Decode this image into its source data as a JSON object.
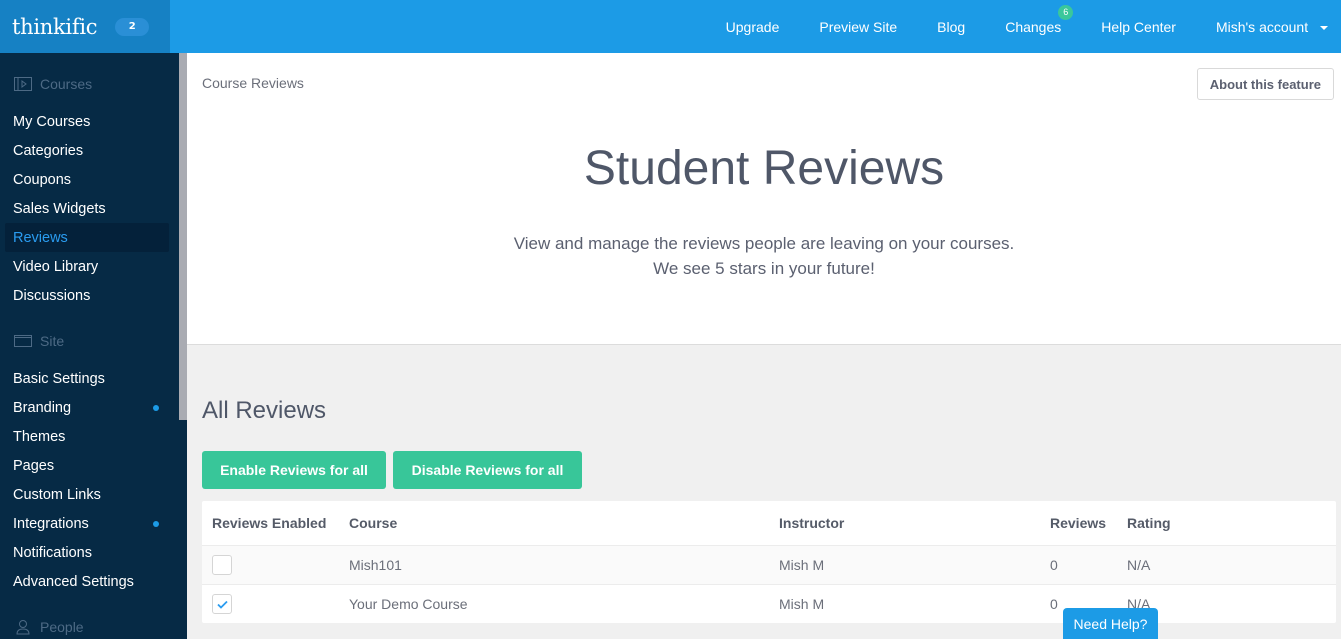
{
  "brand": {
    "logo_text": "thinkific",
    "badge": "2"
  },
  "topnav": {
    "items": [
      {
        "label": "Upgrade"
      },
      {
        "label": "Preview Site"
      },
      {
        "label": "Blog"
      },
      {
        "label": "Changes",
        "badge": "6"
      },
      {
        "label": "Help Center"
      },
      {
        "label": "Mish's account"
      }
    ]
  },
  "sidebar": {
    "sections": [
      {
        "label": "Courses",
        "icon": "course-player-icon"
      },
      {
        "label": "Site",
        "icon": "browser-window-icon"
      },
      {
        "label": "People",
        "icon": "person-icon"
      }
    ],
    "courses_items": [
      {
        "label": "My Courses"
      },
      {
        "label": "Categories"
      },
      {
        "label": "Coupons"
      },
      {
        "label": "Sales Widgets"
      },
      {
        "label": "Reviews",
        "active": true
      },
      {
        "label": "Video Library"
      },
      {
        "label": "Discussions"
      }
    ],
    "site_items": [
      {
        "label": "Basic Settings"
      },
      {
        "label": "Branding",
        "dot": true
      },
      {
        "label": "Themes"
      },
      {
        "label": "Pages"
      },
      {
        "label": "Custom Links"
      },
      {
        "label": "Integrations",
        "dot": true
      },
      {
        "label": "Notifications"
      },
      {
        "label": "Advanced Settings"
      }
    ]
  },
  "main": {
    "breadcrumb": "Course Reviews",
    "about_button": "About this feature",
    "title": "Student Reviews",
    "subtitle_line1": "View and manage the reviews people are leaving on your courses.",
    "subtitle_line2": "We see 5 stars in your future!",
    "section_title": "All Reviews",
    "enable_all": "Enable Reviews for all",
    "disable_all": "Disable Reviews for all",
    "table": {
      "headers": [
        "Reviews Enabled",
        "Course",
        "Instructor",
        "Reviews",
        "Rating"
      ],
      "rows": [
        {
          "enabled": false,
          "course": "Mish101",
          "instructor": "Mish M",
          "reviews": "0",
          "rating": "N/A"
        },
        {
          "enabled": true,
          "course": "Your Demo Course",
          "instructor": "Mish M",
          "reviews": "0",
          "rating": "N/A"
        }
      ]
    }
  },
  "help_button": "Need Help?",
  "colors": {
    "topbar": "#1c9be6",
    "sidebar": "#062a45",
    "accent_green": "#38c699",
    "active_link": "#2a9cf0"
  }
}
